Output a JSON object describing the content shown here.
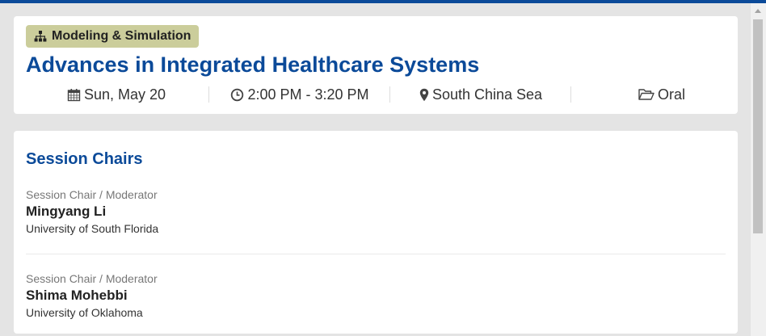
{
  "session": {
    "track": "Modeling & Simulation",
    "title": "Advances in Integrated Healthcare Systems",
    "date": "Sun, May 20",
    "time": "2:00 PM - 3:20 PM",
    "location": "South China Sea",
    "type": "Oral"
  },
  "chairs_section": {
    "title": "Session Chairs",
    "chairs": [
      {
        "role": "Session Chair / Moderator",
        "name": "Mingyang Li",
        "affiliation": "University of South Florida"
      },
      {
        "role": "Session Chair / Moderator",
        "name": "Shima Mohebbi",
        "affiliation": "University of Oklahoma"
      }
    ]
  },
  "colors": {
    "accent": "#0b4a99",
    "badge": "#cbcd9b",
    "background": "#e4e4e4"
  },
  "icons": {
    "track": "sitemap-icon",
    "date": "calendar-icon",
    "time": "clock-icon",
    "location": "map-marker-icon",
    "type": "folder-open-icon"
  }
}
